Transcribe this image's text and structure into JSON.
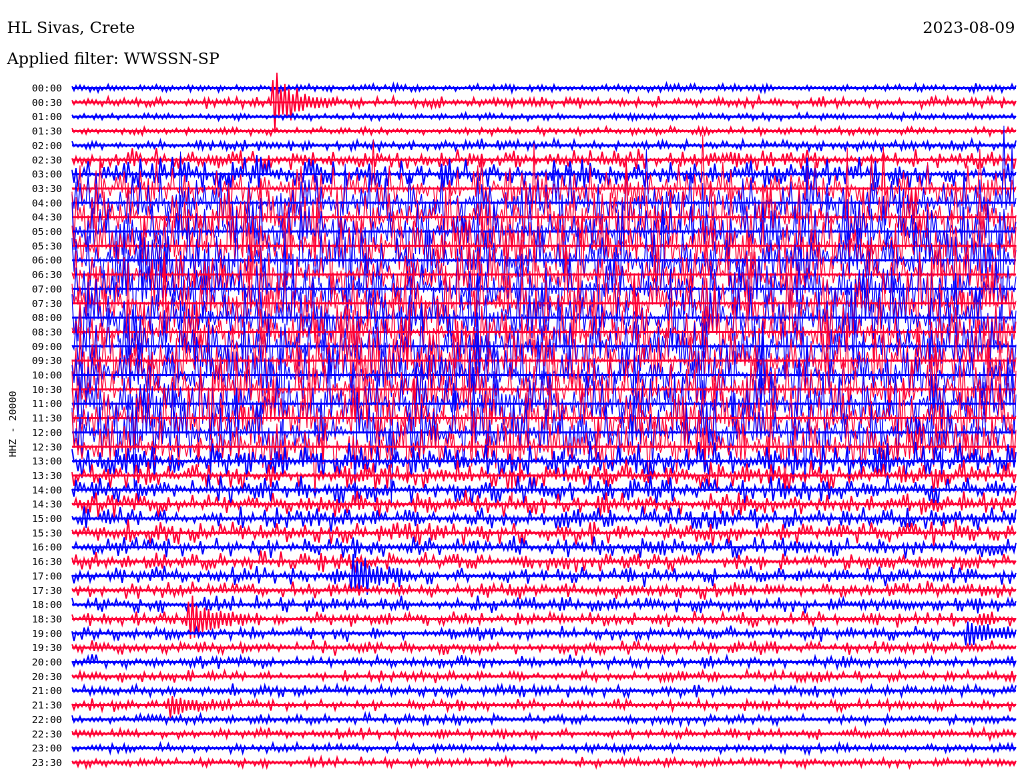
{
  "header": {
    "station": "HL Sivas, Crete",
    "date": "2023-08-09",
    "filter": "Applied filter: WWSSN-SP"
  },
  "chart_data": {
    "type": "line",
    "title": "HL Sivas, Crete",
    "ylabel": "HHZ - 20000",
    "trace_colors": [
      "#0000ff",
      "#ff0033"
    ],
    "rows": [
      "00:00",
      "00:30",
      "01:00",
      "01:30",
      "02:00",
      "02:30",
      "03:00",
      "03:30",
      "04:00",
      "04:30",
      "05:00",
      "05:30",
      "06:00",
      "06:30",
      "07:00",
      "07:30",
      "08:00",
      "08:30",
      "09:00",
      "09:30",
      "10:00",
      "10:30",
      "11:00",
      "11:30",
      "12:00",
      "12:30",
      "13:00",
      "13:30",
      "14:00",
      "14:30",
      "15:00",
      "15:30",
      "16:00",
      "16:30",
      "17:00",
      "17:30",
      "18:00",
      "18:30",
      "19:00",
      "19:30",
      "20:00",
      "20:30",
      "21:00",
      "21:30",
      "22:00",
      "22:30",
      "23:00",
      "23:30"
    ],
    "row_activity": [
      0.1,
      0.15,
      0.08,
      0.1,
      0.15,
      0.3,
      0.5,
      0.7,
      0.9,
      1.0,
      1.0,
      1.0,
      1.0,
      1.0,
      1.0,
      1.0,
      1.0,
      1.0,
      1.0,
      1.0,
      1.0,
      1.0,
      1.0,
      1.0,
      1.0,
      0.8,
      0.55,
      0.45,
      0.4,
      0.38,
      0.35,
      0.33,
      0.3,
      0.28,
      0.26,
      0.24,
      0.22,
      0.2,
      0.2,
      0.18,
      0.18,
      0.16,
      0.16,
      0.15,
      0.14,
      0.14,
      0.13,
      0.12
    ],
    "events": [
      {
        "row": "00:30",
        "minute": 6.5,
        "amplitude": 1.0
      },
      {
        "row": "17:00",
        "minute": 9.0,
        "amplitude": 0.7
      },
      {
        "row": "18:30",
        "minute": 3.8,
        "amplitude": 0.8
      },
      {
        "row": "19:00",
        "minute": 28.5,
        "amplitude": 0.5
      },
      {
        "row": "21:30",
        "minute": 3.2,
        "amplitude": 0.4
      }
    ]
  }
}
